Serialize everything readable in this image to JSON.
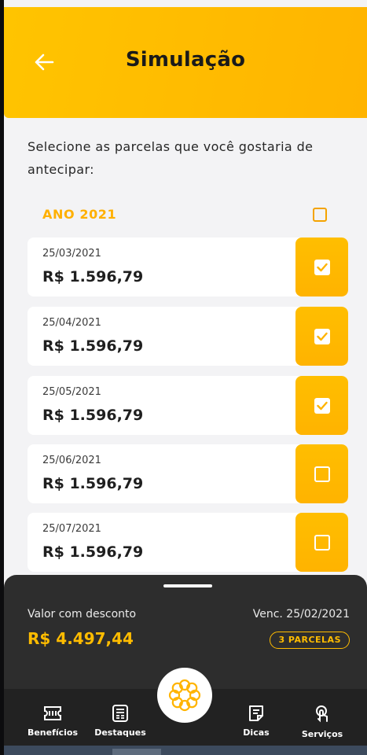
{
  "header": {
    "title": "Simulação",
    "back_icon": "arrow-left-icon",
    "background": "#ffc000"
  },
  "instruction": "Selecione as parcelas que você gostaria de antecipar:",
  "year_group": {
    "label": "ANO 2021",
    "checked": false
  },
  "installments": [
    {
      "date": "25/03/2021",
      "amount": "R$ 1.596,79",
      "checked": true
    },
    {
      "date": "25/04/2021",
      "amount": "R$ 1.596,79",
      "checked": true
    },
    {
      "date": "25/05/2021",
      "amount": "R$ 1.596,79",
      "checked": true
    },
    {
      "date": "25/06/2021",
      "amount": "R$ 1.596,79",
      "checked": false
    },
    {
      "date": "25/07/2021",
      "amount": "R$ 1.596,79",
      "checked": false
    }
  ],
  "summary": {
    "discount_label": "Valor com desconto",
    "discount_value": "R$ 4.497,44",
    "due_label": "Venc. 25/02/2021",
    "parcels_badge": "3 PARCELAS"
  },
  "nav": {
    "items": [
      {
        "label": "Benefícios",
        "icon": "ticket-icon"
      },
      {
        "label": "Destaques",
        "icon": "newspaper-icon"
      },
      {
        "label": "Dicas",
        "icon": "note-icon"
      },
      {
        "label": "Serviços",
        "icon": "touch-icon"
      }
    ],
    "center_icon": "brand-logo-icon"
  },
  "colors": {
    "accent": "#ffb400",
    "sheet": "#2d2d2d",
    "nav": "#222222"
  }
}
